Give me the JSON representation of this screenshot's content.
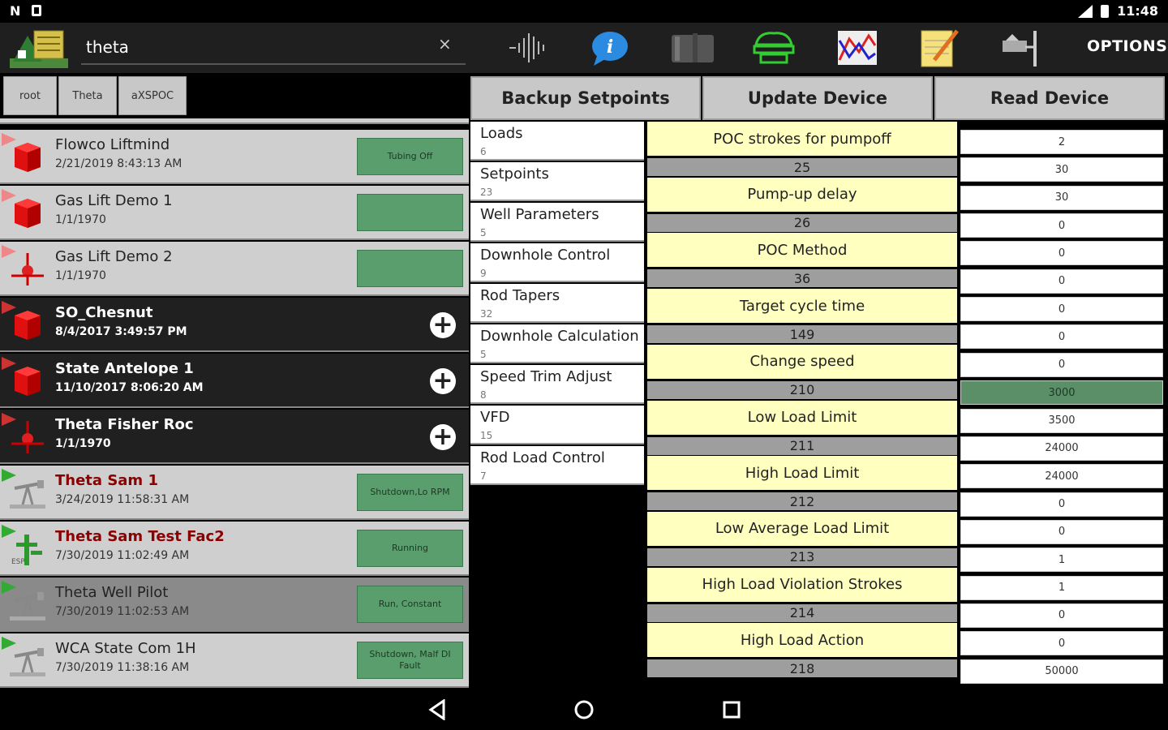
{
  "status_bar": {
    "left_icons": [
      "n-icon",
      "square-icon"
    ],
    "time": "11:48"
  },
  "toolbar": {
    "search_value": "theta",
    "clear_label": "×",
    "options_label": "OPTIONS",
    "icons": [
      "waveform-icon",
      "info-icon",
      "tank-icon",
      "pump-icon",
      "chart-icon",
      "notepad-icon",
      "well-icon"
    ]
  },
  "breadcrumb": [
    "root",
    "Theta",
    "aXSPOC"
  ],
  "devices": [
    {
      "name": "Flowco Liftmind",
      "date": "2/21/2019 8:43:13 AM",
      "status": "Tubing Off",
      "style": "light",
      "icon": "red-cube",
      "flag": "#e88"
    },
    {
      "name": "Gas Lift Demo 1",
      "date": "1/1/1970",
      "status": "",
      "style": "light",
      "icon": "red-cube",
      "flag": "#e88"
    },
    {
      "name": "Gas Lift Demo 2",
      "date": "1/1/1970",
      "status": "",
      "style": "light",
      "icon": "gaslift",
      "flag": "#e88"
    },
    {
      "name": "SO_Chesnut",
      "date": "8/4/2017 3:49:57 PM",
      "status": null,
      "style": "dark",
      "icon": "red-cube",
      "flag": "#c33"
    },
    {
      "name": "State Antelope 1",
      "date": "11/10/2017 8:06:20 AM",
      "status": null,
      "style": "dark",
      "icon": "red-cube",
      "flag": "#c33"
    },
    {
      "name": "Theta Fisher Roc",
      "date": "1/1/1970",
      "status": null,
      "style": "dark",
      "icon": "gaslift",
      "flag": "#c33"
    },
    {
      "name": "Theta Sam 1",
      "date": "3/24/2019 11:58:31 AM",
      "status": "Shutdown,Lo RPM",
      "style": "light",
      "icon": "pumpjack",
      "flag": "#3a3",
      "red": true
    },
    {
      "name": "Theta Sam Test Fac2",
      "date": "7/30/2019 11:02:49 AM",
      "status": "Running",
      "style": "light",
      "icon": "esp",
      "flag": "#3a3",
      "red": true
    },
    {
      "name": "Theta Well Pilot",
      "date": "7/30/2019 11:02:53 AM",
      "status": "Run, Constant",
      "style": "selected",
      "icon": "pumpjack",
      "flag": "#3a3"
    },
    {
      "name": "WCA State Com 1H",
      "date": "7/30/2019 11:38:16 AM",
      "status": "Shutdown, Malf DI Fault",
      "style": "light",
      "icon": "pumpjack",
      "flag": "#3a3"
    }
  ],
  "actions": [
    "Backup Setpoints",
    "Update Device",
    "Read Device"
  ],
  "categories": [
    {
      "name": "Loads",
      "count": "6"
    },
    {
      "name": "Setpoints",
      "count": "23"
    },
    {
      "name": "Well Parameters",
      "count": "5"
    },
    {
      "name": "Downhole Control",
      "count": "9"
    },
    {
      "name": "Rod Tapers",
      "count": "32"
    },
    {
      "name": "Downhole Calculation",
      "count": "5"
    },
    {
      "name": "Speed Trim Adjust",
      "count": "8"
    },
    {
      "name": "VFD",
      "count": "15"
    },
    {
      "name": "Rod Load Control",
      "count": "7"
    }
  ],
  "parameters": [
    {
      "name": "POC strokes for pumpoff",
      "register": "25"
    },
    {
      "name": "Pump-up delay",
      "register": "26"
    },
    {
      "name": "POC Method",
      "register": "36"
    },
    {
      "name": "Target cycle time",
      "register": "149"
    },
    {
      "name": "Change speed",
      "register": "210"
    },
    {
      "name": "Low Load Limit",
      "register": "211"
    },
    {
      "name": "High Load Limit",
      "register": "212"
    },
    {
      "name": "Low Average Load Limit",
      "register": "213"
    },
    {
      "name": "High Load Violation Strokes",
      "register": "214"
    },
    {
      "name": "High Load Action",
      "register": "218"
    }
  ],
  "values": [
    "2",
    "30",
    "30",
    "0",
    "0",
    "0",
    "0",
    "0",
    "0",
    "3000",
    "3500",
    "24000",
    "24000",
    "0",
    "0",
    "1",
    "1",
    "0",
    "0",
    "50000"
  ],
  "highlight_value_index": 9,
  "colors": {
    "status_green": "#5a9e6e",
    "param_yellow": "#ffffc0",
    "register_gray": "#9e9e9e"
  }
}
